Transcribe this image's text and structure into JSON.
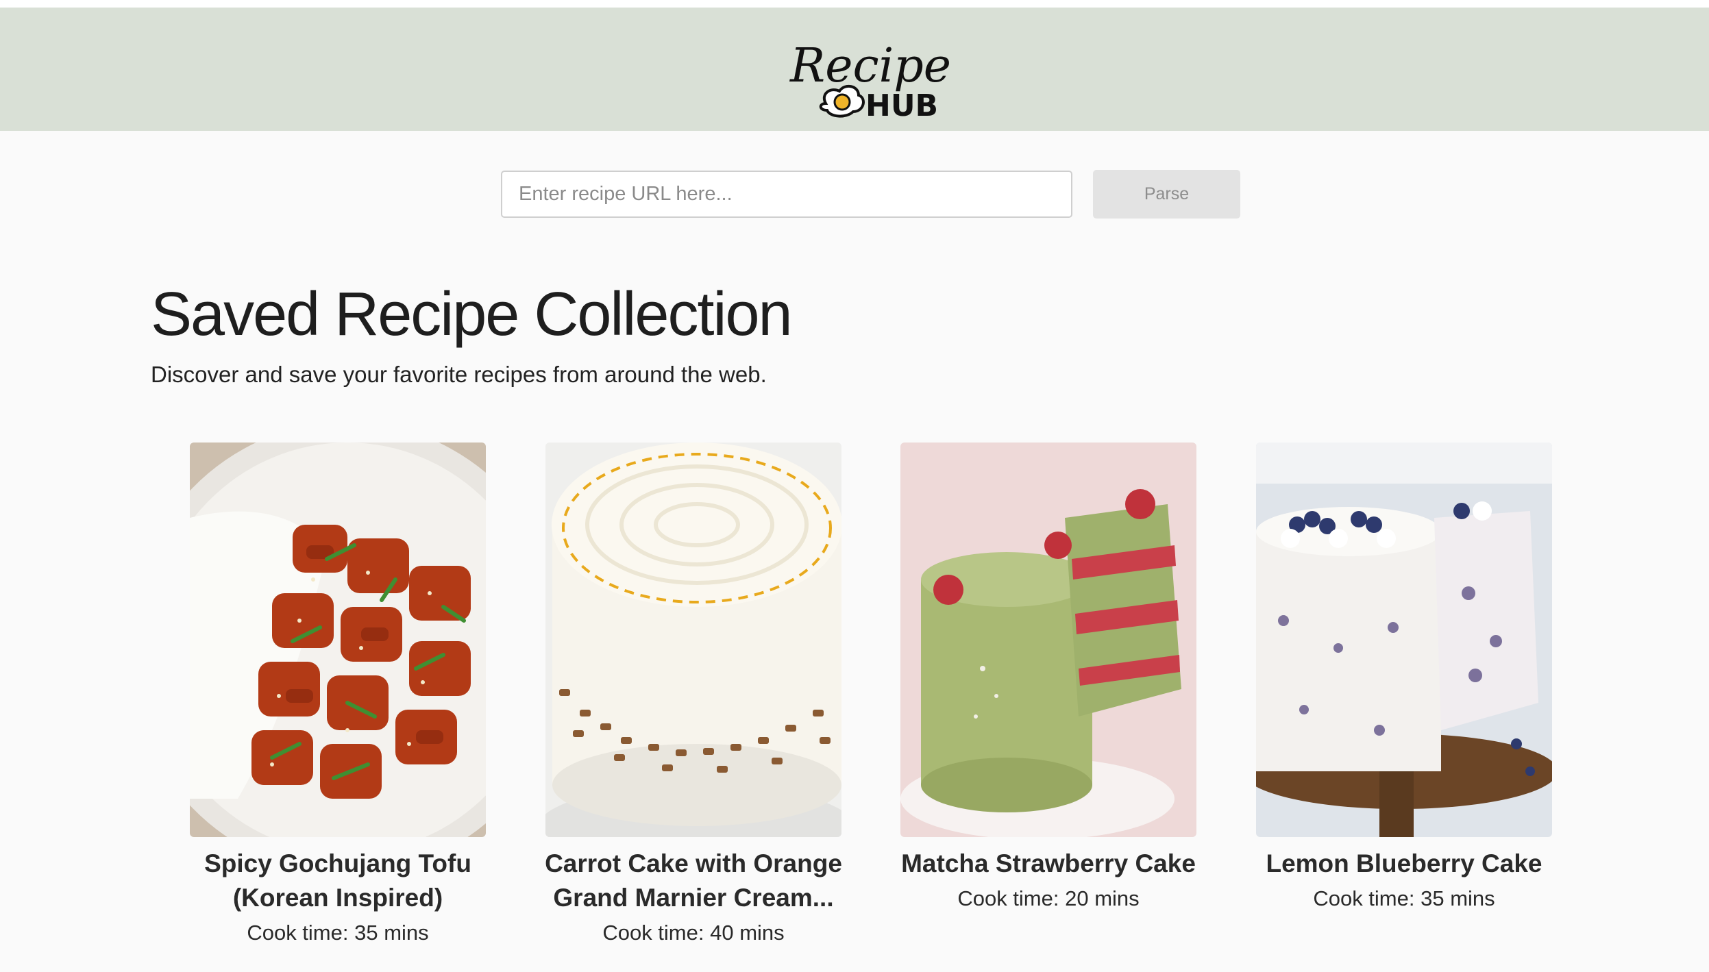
{
  "header": {
    "logo_text_top": "Recipe",
    "logo_text_bottom": "HUB"
  },
  "search": {
    "placeholder": "Enter recipe URL here...",
    "value": "",
    "button_label": "Parse"
  },
  "main": {
    "title": "Saved Recipe Collection",
    "subtitle": "Discover and save your favorite recipes from around the web."
  },
  "recipes": [
    {
      "title_lines": [
        "Spicy Gochujang Tofu",
        "(Korean Inspired)"
      ],
      "cook_time": "Cook time: 35 mins",
      "image": "gochujang-tofu-photo"
    },
    {
      "title_lines": [
        "Carrot Cake with Orange",
        "Grand Marnier Cream..."
      ],
      "cook_time": "Cook time: 40 mins",
      "image": "carrot-cake-photo"
    },
    {
      "title_lines": [
        "Matcha Strawberry Cake"
      ],
      "cook_time": "Cook time: 20 mins",
      "image": "matcha-strawberry-cake-photo"
    },
    {
      "title_lines": [
        "Lemon Blueberry Cake"
      ],
      "cook_time": "Cook time: 35 mins",
      "image": "lemon-blueberry-cake-photo"
    }
  ],
  "colors": {
    "header_bg": "#d9e0d6",
    "page_bg": "#fafafa",
    "button_bg": "#e3e3e3",
    "button_text": "#8d8d8d"
  }
}
